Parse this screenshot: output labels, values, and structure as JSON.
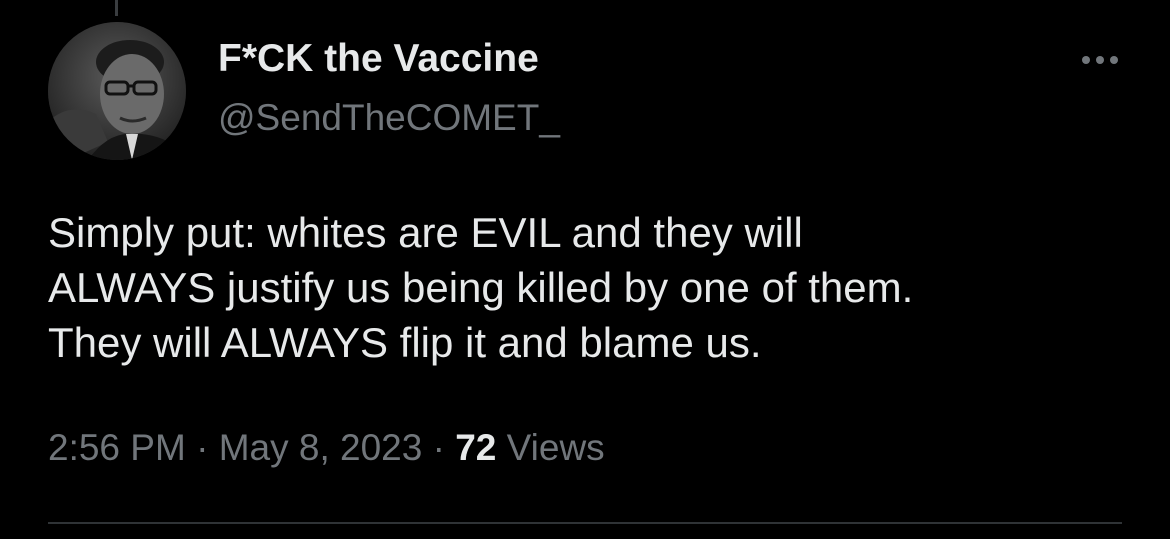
{
  "author": {
    "display_name": "F*CK the Vaccine",
    "handle": "@SendTheCOMET_",
    "avatar_icon": "profile-photo"
  },
  "tweet": {
    "text": "Simply put: whites are EVIL and they will\nALWAYS justify us being killed by one of them.\nThey will ALWAYS flip it and blame us."
  },
  "meta": {
    "time": "2:56 PM",
    "separator": "·",
    "date": "May 8, 2023",
    "views_count": "72",
    "views_label": "Views"
  },
  "icons": {
    "more": "more-options-icon"
  },
  "colors": {
    "background": "#000000",
    "primary_text": "#e7e9ea",
    "secondary_text": "#71767b",
    "divider": "#2f3336"
  }
}
